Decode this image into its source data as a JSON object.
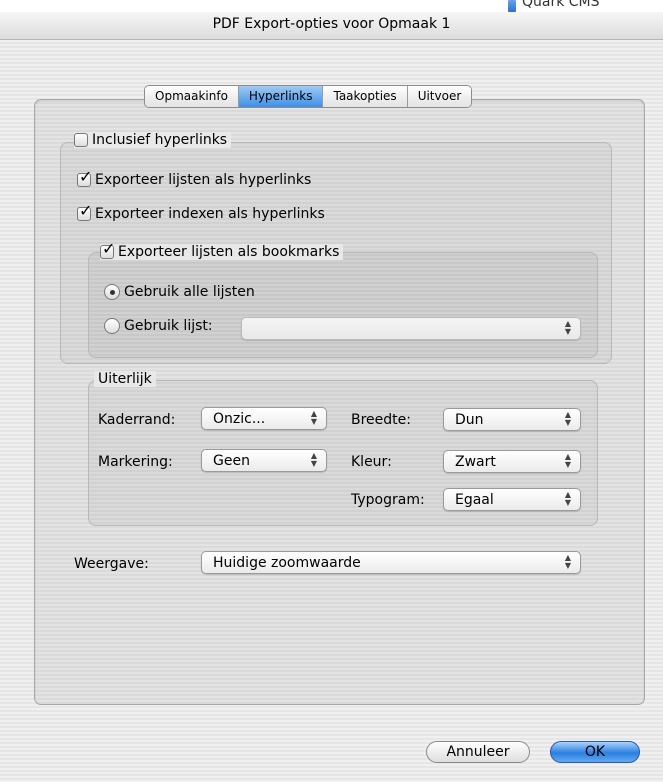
{
  "background_app": {
    "label": "Quark CMS"
  },
  "window": {
    "title": "PDF Export-opties voor Opmaak 1"
  },
  "tabs": [
    {
      "label": "Opmaakinfo",
      "active": false
    },
    {
      "label": "Hyperlinks",
      "active": true
    },
    {
      "label": "Taakopties",
      "active": false
    },
    {
      "label": "Uitvoer",
      "active": false
    }
  ],
  "hyperlinks": {
    "include": {
      "label": "Inclusief hyperlinks",
      "checked": false
    },
    "export_lists": {
      "label": "Exporteer lijsten als hyperlinks",
      "checked": true
    },
    "export_indexes": {
      "label": "Exporteer indexen als hyperlinks",
      "checked": true
    },
    "bookmarks": {
      "label": "Exporteer lijsten als bookmarks",
      "checked": true,
      "use_all": {
        "label": "Gebruik alle lijsten",
        "selected": true
      },
      "use_list": {
        "label": "Gebruik lijst:",
        "selected": false,
        "value": ""
      }
    }
  },
  "appearance": {
    "title": "Uiterlijk",
    "frame": {
      "label": "Kaderrand:",
      "value": "Onzic..."
    },
    "highlight": {
      "label": "Markering:",
      "value": "Geen"
    },
    "width": {
      "label": "Breedte:",
      "value": "Dun"
    },
    "color": {
      "label": "Kleur:",
      "value": "Zwart"
    },
    "typogram": {
      "label": "Typogram:",
      "value": "Egaal"
    }
  },
  "display": {
    "label": "Weergave:",
    "value": "Huidige zoomwaarde"
  },
  "buttons": {
    "cancel": "Annuleer",
    "ok": "OK"
  },
  "colors": {
    "accent": "#3e8fe6",
    "ok_button": "#2a7fe0"
  }
}
